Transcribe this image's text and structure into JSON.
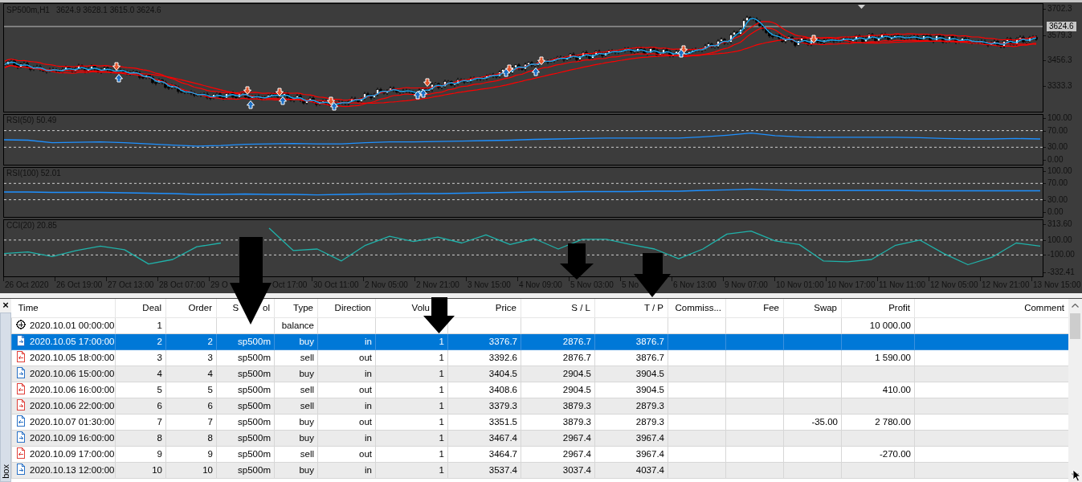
{
  "chart": {
    "symbol": "SP500m,H1",
    "ohlc": "3624.9 3628.1 3615.0 3624.6",
    "price_axis": [
      {
        "text": "3702.3",
        "kind": "tick"
      },
      {
        "text": "3624.6",
        "kind": "current"
      },
      {
        "text": "3579.3",
        "kind": "tick"
      },
      {
        "text": "3456.3",
        "kind": "tick"
      },
      {
        "text": "3333.3",
        "kind": "tick"
      }
    ],
    "indicators": [
      {
        "chart_data": {
          "type": "line",
          "title": "RSI(50) 50.49",
          "ylim": [
            -12,
            108
          ],
          "yticks": [
            {
              "value": 100,
              "label": "100.00"
            },
            {
              "value": 70,
              "label": "70.00"
            },
            {
              "value": 30,
              "label": "30.00"
            },
            {
              "value": 0,
              "label": "0.00"
            }
          ],
          "series": [
            {
              "color": "#1e90ff",
              "values": [
                48,
                47,
                41,
                42,
                43,
                41,
                38,
                35,
                33,
                34,
                37,
                38,
                39,
                38,
                38,
                41,
                43,
                43,
                44,
                45,
                46,
                47,
                49,
                50,
                51,
                52,
                52,
                52,
                52,
                55,
                59,
                64,
                58,
                55,
                54,
                54,
                54,
                54,
                53,
                51,
                50,
                50,
                51,
                50
              ]
            }
          ]
        }
      },
      {
        "chart_data": {
          "type": "line",
          "title": "RSI(100) 52.01",
          "ylim": [
            -12,
            108
          ],
          "yticks": [
            {
              "value": 100,
              "label": "100.00"
            },
            {
              "value": 70,
              "label": "70.00"
            },
            {
              "value": 30,
              "label": "30.00"
            },
            {
              "value": 0,
              "label": "0.00"
            }
          ],
          "series": [
            {
              "color": "#1e90ff",
              "values": [
                49,
                49,
                48,
                48,
                48,
                47,
                46,
                45,
                43,
                43,
                44,
                43,
                43,
                42,
                43,
                44,
                44,
                45,
                45,
                46,
                47,
                48,
                49,
                49,
                50,
                50,
                50,
                51,
                51,
                53,
                54,
                56,
                54,
                53,
                53,
                53,
                53,
                53,
                52,
                52,
                52,
                52,
                52,
                52
              ]
            }
          ]
        }
      },
      {
        "chart_data": {
          "type": "line",
          "title": "CCI(20) 20.85",
          "ylim": [
            -386,
            367
          ],
          "yticks": [
            {
              "value": 313.6,
              "label": "313.60"
            },
            {
              "value": 100,
              "label": "100.00"
            },
            {
              "value": -100,
              "label": "-100.00"
            },
            {
              "value": -332.41,
              "label": "-332.41"
            }
          ],
          "series": [
            {
              "color": "#20b2aa",
              "values": [
                -80,
                -60,
                -120,
                -40,
                20,
                -30,
                -220,
                -160,
                10,
                60,
                null,
                260,
                -40,
                -20,
                -180,
                30,
                150,
                80,
                140,
                60,
                170,
                40,
                120,
                -20,
                110,
                110,
                40,
                -20,
                -150,
                -20,
                180,
                220,
                90,
                40,
                -180,
                -190,
                -160,
                30,
                100,
                -80,
                -230,
                -130,
                60,
                20
              ]
            }
          ]
        }
      }
    ],
    "time_axis": [
      {
        "text": "26 Oct 2020",
        "hidden_start": false
      },
      {
        "text": "26 Oct 19:00",
        "hidden_start": false
      },
      {
        "text": "27 Oct 13:00",
        "hidden_start": false
      },
      {
        "text": "28 Oct 07:00",
        "hidden_start": false
      },
      {
        "text": "29 O",
        "hidden_start": false
      },
      {
        "text": "Oct 17:00",
        "hidden_start": true
      },
      {
        "text": "30 Oct 11:00",
        "hidden_start": false
      },
      {
        "text": "2 Nov 05:00",
        "hidden_start": false
      },
      {
        "text": "2 Nov 21:00",
        "hidden_start": false
      },
      {
        "text": "3 Nov 15:00",
        "hidden_start": false
      },
      {
        "text": "4 Nov 09:00",
        "hidden_start": false
      },
      {
        "text": "5 Nov 03:00",
        "hidden_start": false
      },
      {
        "text": "5 No",
        "hidden_start": false
      },
      {
        "text": "6 Nov 13:00",
        "hidden_start": false
      },
      {
        "text": "9 Nov 07:00",
        "hidden_start": false
      },
      {
        "text": "10 Nov 01:00",
        "hidden_start": false
      },
      {
        "text": "10 Nov 17:00",
        "hidden_start": false
      },
      {
        "text": "11 Nov 11:00",
        "hidden_start": false
      },
      {
        "text": "12 Nov 05:00",
        "hidden_start": false
      },
      {
        "text": "12 Nov 21:00",
        "hidden_start": false
      },
      {
        "text": "13 Nov 15:00",
        "hidden_start": false
      }
    ]
  },
  "toolbox": {
    "close": "×",
    "tab": "box",
    "columns": [
      {
        "parts": [
          "Time"
        ],
        "hidden_end": false
      },
      {
        "parts": [
          "Deal"
        ],
        "hidden_end": false
      },
      {
        "parts": [
          "Order"
        ],
        "hidden_end": false
      },
      {
        "parts": [
          "S",
          "ol"
        ],
        "hidden_end": false
      },
      {
        "parts": [
          "Type"
        ],
        "hidden_end": false
      },
      {
        "parts": [
          "Direction"
        ],
        "hidden_end": false
      },
      {
        "parts": [
          "Volu"
        ],
        "hidden_end": true
      },
      {
        "parts": [
          "Price"
        ],
        "hidden_end": false
      },
      {
        "parts": [
          "S / L"
        ],
        "hidden_end": false
      },
      {
        "parts": [
          "T / P"
        ],
        "hidden_end": false
      },
      {
        "parts": [
          "Commiss..."
        ],
        "hidden_end": false
      },
      {
        "parts": [
          "Fee"
        ],
        "hidden_end": false
      },
      {
        "parts": [
          "Swap"
        ],
        "hidden_end": false
      },
      {
        "parts": [
          "Profit"
        ],
        "hidden_end": false
      },
      {
        "parts": [
          "Comment"
        ],
        "hidden_end": false
      }
    ],
    "rows": [
      {
        "kind": "balance",
        "color": "#1a1a1a",
        "selected": false,
        "time": "2020.10.01 00:00:00",
        "deal": "1",
        "type": "balance",
        "profit": "10 000.00"
      },
      {
        "kind": "in",
        "color": "#2a72c6",
        "selected": true,
        "time": "2020.10.05 17:00:00",
        "deal": "2",
        "order": "2",
        "symbol": "sp500m",
        "type": "buy",
        "direction": "in",
        "volume": "1",
        "price": "3376.7",
        "sl": "2876.7",
        "tp": "3876.7"
      },
      {
        "kind": "out",
        "color": "#e0403a",
        "selected": false,
        "time": "2020.10.05 18:00:00",
        "deal": "3",
        "order": "3",
        "symbol": "sp500m",
        "type": "sell",
        "direction": "out",
        "volume": "1",
        "price": "3392.6",
        "sl": "2876.7",
        "tp": "3876.7",
        "profit": "1 590.00"
      },
      {
        "kind": "in",
        "color": "#2a72c6",
        "selected": false,
        "time": "2020.10.06 15:00:00",
        "deal": "4",
        "order": "4",
        "symbol": "sp500m",
        "type": "buy",
        "direction": "in",
        "volume": "1",
        "price": "3404.5",
        "sl": "2904.5",
        "tp": "3904.5"
      },
      {
        "kind": "out",
        "color": "#e0403a",
        "selected": false,
        "time": "2020.10.06 16:00:00",
        "deal": "5",
        "order": "5",
        "symbol": "sp500m",
        "type": "sell",
        "direction": "out",
        "volume": "1",
        "price": "3408.6",
        "sl": "2904.5",
        "tp": "3904.5",
        "profit": "410.00"
      },
      {
        "kind": "in",
        "color": "#e0403a",
        "selected": false,
        "time": "2020.10.06 22:00:00",
        "deal": "6",
        "order": "6",
        "symbol": "sp500m",
        "type": "sell",
        "direction": "in",
        "volume": "1",
        "price": "3379.3",
        "sl": "3879.3",
        "tp": "2879.3"
      },
      {
        "kind": "out",
        "color": "#2a72c6",
        "selected": false,
        "time": "2020.10.07 01:30:00",
        "deal": "7",
        "order": "7",
        "symbol": "sp500m",
        "type": "buy",
        "direction": "out",
        "volume": "1",
        "price": "3351.5",
        "sl": "3879.3",
        "tp": "2879.3",
        "swap": "-35.00",
        "profit": "2 780.00"
      },
      {
        "kind": "in",
        "color": "#2a72c6",
        "selected": false,
        "time": "2020.10.09 16:00:00",
        "deal": "8",
        "order": "8",
        "symbol": "sp500m",
        "type": "buy",
        "direction": "in",
        "volume": "1",
        "price": "3467.4",
        "sl": "2967.4",
        "tp": "3967.4"
      },
      {
        "kind": "out",
        "color": "#e0403a",
        "selected": false,
        "time": "2020.10.09 17:00:00",
        "deal": "9",
        "order": "9",
        "symbol": "sp500m",
        "type": "sell",
        "direction": "out",
        "volume": "1",
        "price": "3464.7",
        "sl": "2967.4",
        "tp": "3967.4",
        "profit": "-270.00"
      },
      {
        "kind": "in",
        "color": "#2a72c6",
        "selected": false,
        "time": "2020.10.13 12:00:00",
        "deal": "10",
        "order": "10",
        "symbol": "sp500m",
        "type": "buy",
        "direction": "in",
        "volume": "1",
        "price": "3537.4",
        "sl": "3037.4",
        "tp": "4037.4"
      }
    ]
  }
}
